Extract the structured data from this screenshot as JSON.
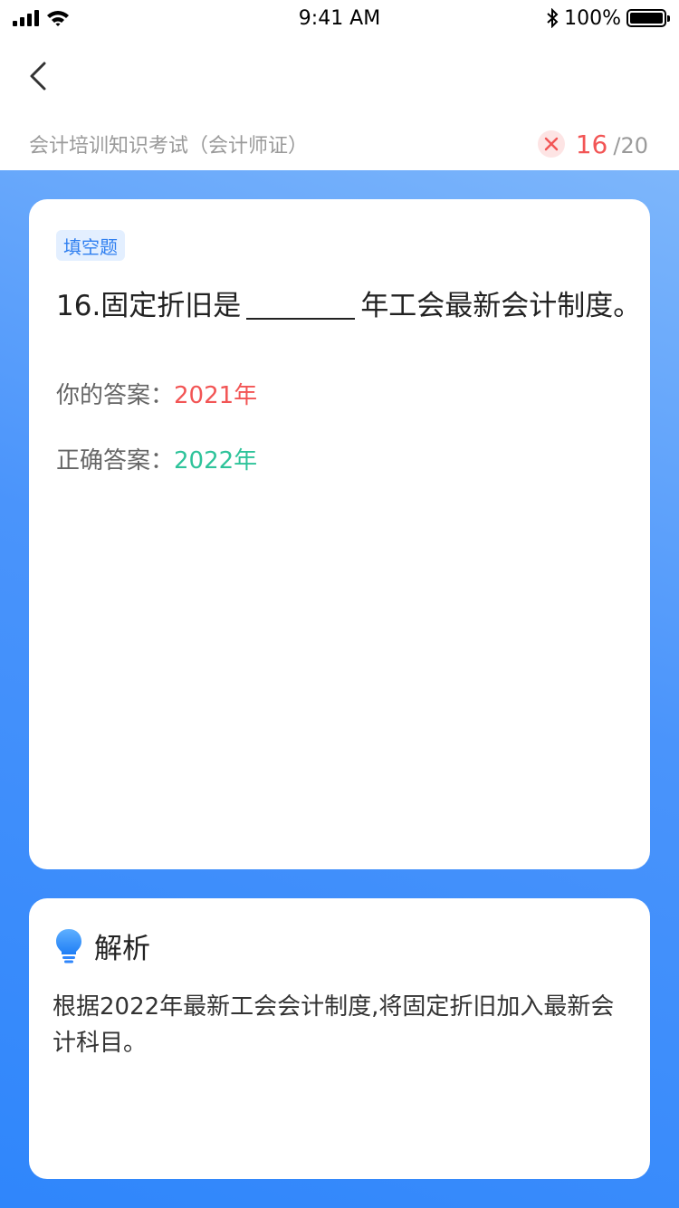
{
  "status_bar": {
    "time": "9:41 AM",
    "battery": "100%"
  },
  "exam": {
    "title": "会计培训知识考试（会计师证）",
    "current": "16",
    "total": "/20"
  },
  "question": {
    "type_tag": "填空题",
    "text_before": "16.固定折旧是",
    "text_after": "年工会最新会计制度。",
    "your_answer_label": "你的答案：",
    "your_answer": "2021年",
    "correct_answer_label": "正确答案：",
    "correct_answer": "2022年"
  },
  "analysis": {
    "title": "解析",
    "body": "根据2022年最新工会会计制度,将固定折旧加入最新会计科目。"
  },
  "colors": {
    "accent": "#2f86fb",
    "wrong": "#f25555",
    "correct": "#2ec39a",
    "tag_bg": "#e3efff"
  },
  "icons": [
    "signal-icon",
    "wifi-icon",
    "bluetooth-icon",
    "battery-icon",
    "back-icon",
    "wrong-x-icon",
    "lightbulb-icon"
  ]
}
